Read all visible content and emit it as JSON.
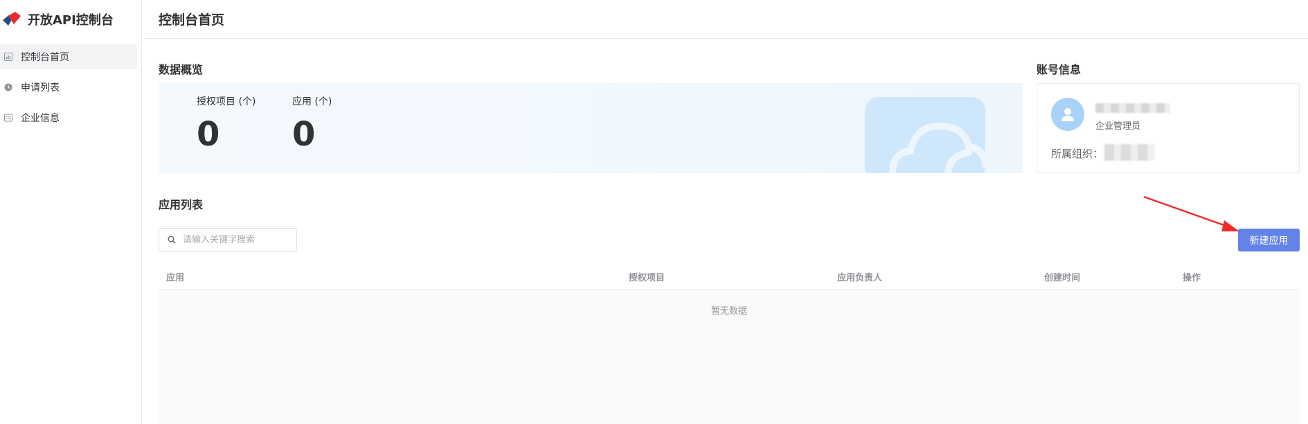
{
  "brand": {
    "title": "开放API控制台"
  },
  "sidebar": {
    "items": [
      {
        "label": "控制台首页",
        "icon": "bar-chart-icon",
        "active": true
      },
      {
        "label": "申请列表",
        "icon": "clock-icon",
        "active": false
      },
      {
        "label": "企业信息",
        "icon": "list-icon",
        "active": false
      }
    ]
  },
  "header": {
    "title": "控制台首页"
  },
  "overview": {
    "title": "数据概览",
    "stats": [
      {
        "label": "授权项目 (个)",
        "value": "0"
      },
      {
        "label": "应用 (个)",
        "value": "0"
      }
    ]
  },
  "account": {
    "title": "账号信息",
    "role": "企业管理员",
    "org_label": "所属组织："
  },
  "apps": {
    "title": "应用列表",
    "search_placeholder": "请输入关键字搜索",
    "new_button": "新建应用",
    "columns": [
      "应用",
      "授权项目",
      "应用负责人",
      "创建时间",
      "操作"
    ],
    "empty_text": "暂无数据"
  },
  "colors": {
    "primary_button": "#6483e8",
    "annotation_arrow": "#f02b2b",
    "avatar": "#a8d2f7"
  }
}
